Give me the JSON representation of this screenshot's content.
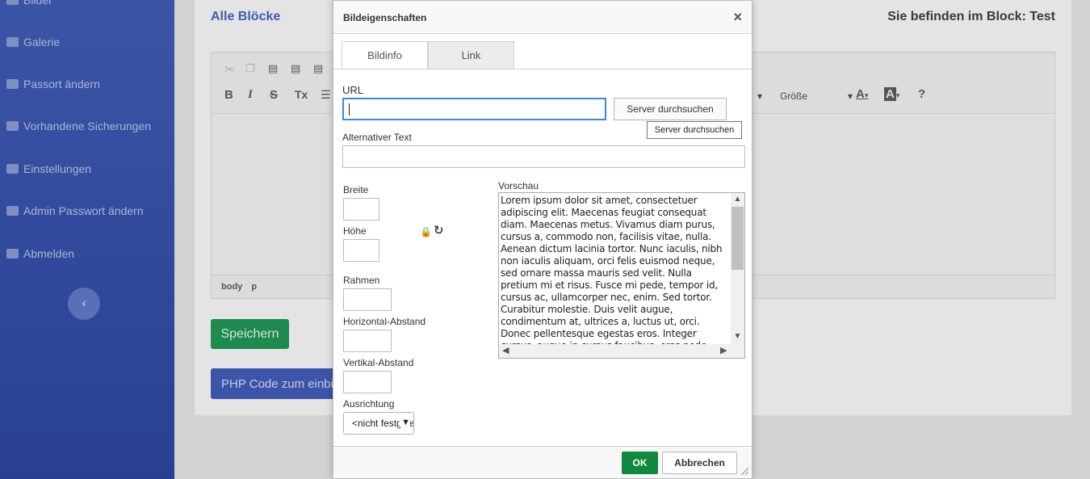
{
  "sidebar": {
    "items": [
      {
        "label": "Bilder",
        "icon": "image-icon"
      },
      {
        "label": "Galerie",
        "icon": "gallery-icon"
      },
      {
        "label": "Passort ändern",
        "icon": "users-icon"
      },
      {
        "label": "Vorhandene Sicherungen",
        "icon": "archive-icon"
      },
      {
        "label": "Einstellungen",
        "icon": "gears-icon"
      },
      {
        "label": "Admin Passwort ändern",
        "icon": "user-icon"
      },
      {
        "label": "Abmelden",
        "icon": "logout-icon"
      }
    ],
    "collapse": "‹"
  },
  "main": {
    "title": "Alle Blöcke",
    "location_prefix": "Sie befinden im Block:",
    "location_block": "Test",
    "toolbar": {
      "bold": "B",
      "italic": "I",
      "strike": "S",
      "clear_format": "Tx",
      "size_label": "Größe",
      "text_color": "A",
      "bg_color": "A",
      "help": "?"
    },
    "status": {
      "path1": "body",
      "path2": "p"
    },
    "save_label": "Speichern",
    "php_label": "PHP Code zum einbinden"
  },
  "dialog": {
    "title": "Bildeigenschaften",
    "close": "×",
    "tabs": [
      {
        "label": "Bildinfo",
        "active": true
      },
      {
        "label": "Link",
        "active": false
      }
    ],
    "url_label": "URL",
    "url_value": "",
    "browse_label": "Server durchsuchen",
    "tooltip": "Server durchsuchen",
    "alt_label": "Alternativer Text",
    "alt_value": "",
    "width_label": "Breite",
    "height_label": "Höhe",
    "border_label": "Rahmen",
    "hspace_label": "Horizontal-Abstand",
    "vspace_label": "Vertikal-Abstand",
    "align_label": "Ausrichtung",
    "align_value": "<nicht festgelegt>",
    "preview_label": "Vorschau",
    "preview_text": "Lorem ipsum dolor sit amet, consectetuer adipiscing elit. Maecenas feugiat consequat diam. Maecenas metus. Vivamus diam purus, cursus a, commodo non, facilisis vitae, nulla. Aenean dictum lacinia tortor. Nunc iaculis, nibh non iaculis aliquam, orci felis euismod neque, sed ornare massa mauris sed velit. Nulla pretium mi et risus. Fusce mi pede, tempor id, cursus ac, ullamcorper nec, enim. Sed tortor. Curabitur molestie. Duis velit augue, condimentum at, ultrices a, luctus ut, orci. Donec pellentesque egestas eros. Integer cursus, augue in cursus faucibus, eros pede bibendum sem, in tempus tellus justo quis ligula. Etiam eget tortor.",
    "ok_label": "OK",
    "cancel_label": "Abbrechen"
  }
}
